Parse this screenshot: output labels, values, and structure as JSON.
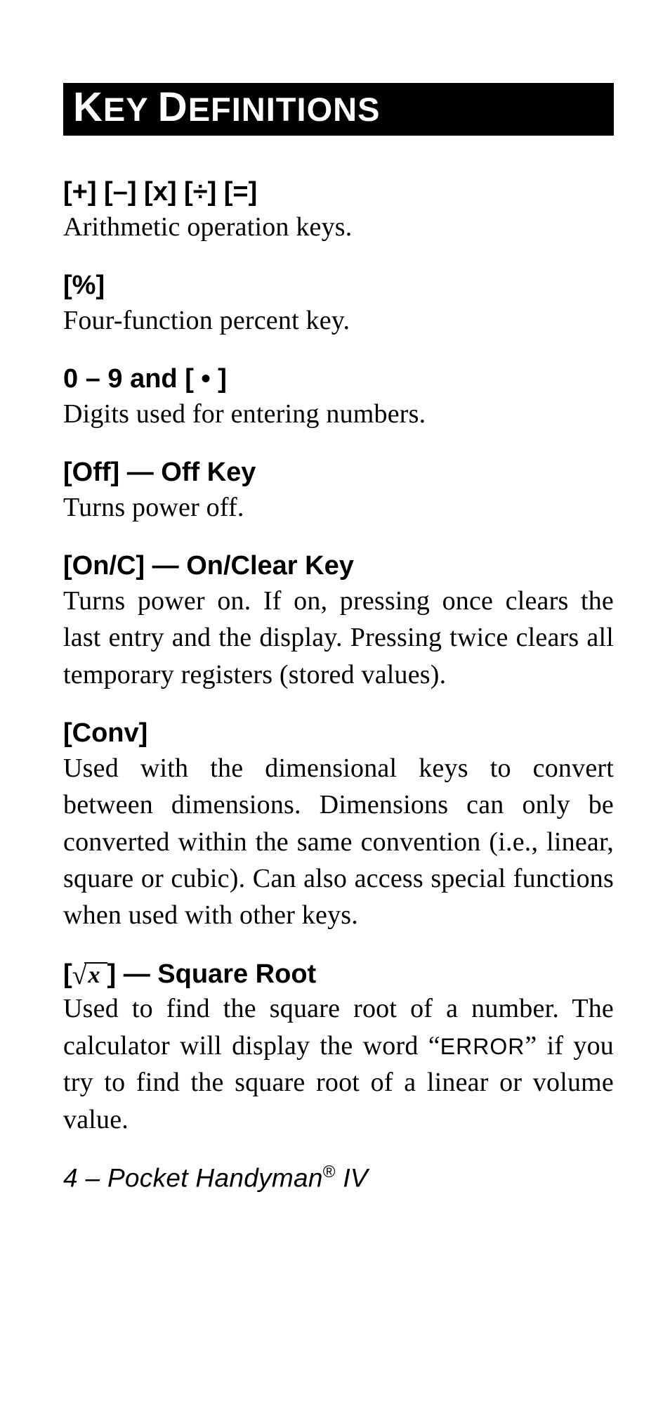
{
  "header": {
    "title_html": "<span class='cap'>K</span>EY <span class='cap'>D</span>EFINITIONS"
  },
  "entries": [
    {
      "term": "[+] [–] [x] [÷] [=]",
      "desc": "Arithmetic operation keys."
    },
    {
      "term": "[%]",
      "desc": "Four-function percent key."
    },
    {
      "term": "0 – 9 and [ • ]",
      "desc": "Digits used for entering numbers."
    },
    {
      "term": "[Off] — Off Key",
      "desc": "Turns power off."
    },
    {
      "term": "[On/C] — On/Clear Key",
      "desc": "Turns power on. If on, pressing once clears the last entry and the display. Pressing twice clears all temporary reg­isters (stored values)."
    },
    {
      "term": "[Conv]",
      "desc": "Used with the dimensional keys to con­vert between dimensions. Dimensions can only be converted within the same convention (i.e., linear, square or cubic). Can also access special func­tions when used with other keys."
    },
    {
      "term_is_sqrt": true,
      "term_prefix": "[",
      "term_suffix": "] — Square Root",
      "sqrt_var": "x",
      "desc_before_error": "Used to find the square root of a num­ber. The calculator will display the word “",
      "error_word": "ERROR",
      "desc_after_error": "” if you try to find the square root of a linear or volume value."
    }
  ],
  "footer": {
    "page_num": "4",
    "sep": " – ",
    "product_name": "Pocket Handyman",
    "reg_mark": "®",
    "version": " IV"
  }
}
